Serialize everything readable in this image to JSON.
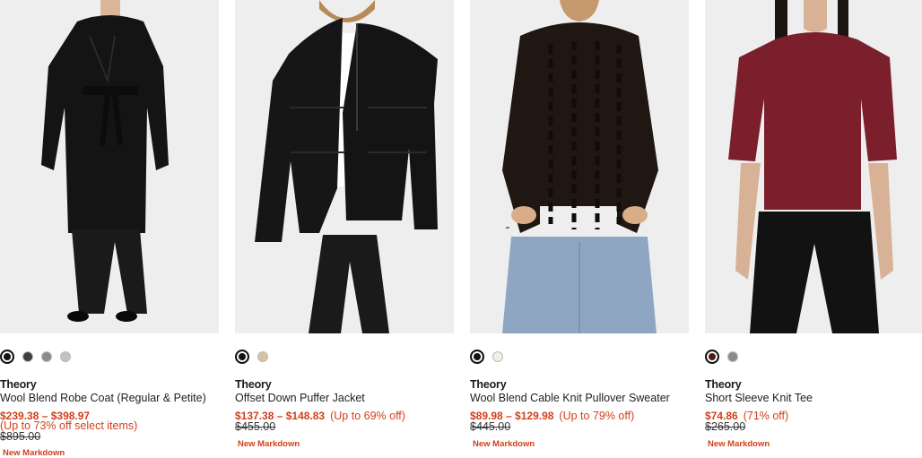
{
  "products": [
    {
      "brand": "Theory",
      "name": "Wool Blend Robe Coat (Regular & Petite)",
      "price": "$239.38 – $398.97",
      "discount": "(Up to 73% off select items)",
      "original_price": "$895.00",
      "badge": "New Markdown",
      "image_alt": "model wearing black wool robe coat",
      "swatches": [
        "#111111",
        "#3b4042",
        "#8a8a8a",
        "#c9bfc6"
      ],
      "selected_swatch": 0
    },
    {
      "brand": "Theory",
      "name": "Offset Down Puffer Jacket",
      "price": "$137.38 – $148.83",
      "discount": "(Up to 69% off)",
      "original_price": "$455.00",
      "badge": "New Markdown",
      "image_alt": "model wearing black puffer jacket",
      "swatches": [
        "#111111",
        "#d6c3a2"
      ],
      "selected_swatch": 0
    },
    {
      "brand": "Theory",
      "name": "Wool Blend Cable Knit Pullover Sweater",
      "price": "$89.98 – $129.98",
      "discount": "(Up to 79% off)",
      "original_price": "$445.00",
      "badge": "New Markdown",
      "image_alt": "model wearing dark cable knit sweater",
      "swatches": [
        "#1b1210",
        "#f3efe4"
      ],
      "selected_swatch": 0
    },
    {
      "brand": "Theory",
      "name": "Short Sleeve Knit Tee",
      "price": "$74.86",
      "discount": "(71% off)",
      "original_price": "$265.00",
      "badge": "New Markdown",
      "image_alt": "model wearing burgundy short sleeve knit tee",
      "swatches": [
        "#4e1a18",
        "#8a8a8a"
      ],
      "selected_swatch": 0
    }
  ],
  "colors": {
    "sale": "#d2401b",
    "image_bg": "#eeeeef"
  }
}
